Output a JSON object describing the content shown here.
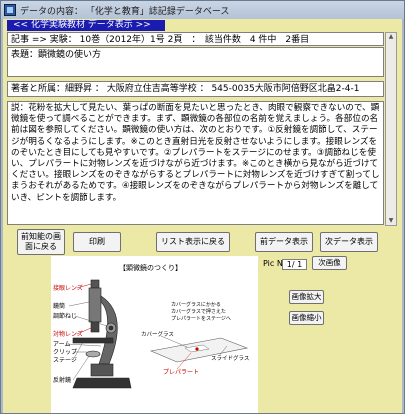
{
  "window": {
    "title": "データの内容： 「化学と教育」誌記録データベース"
  },
  "banner": "<< 化学実験教材 データ表示 >>",
  "record": {
    "text": "記事 => 実験： 10巻（2012年）1号 2頁　：　該当件数　4 件中　2番目"
  },
  "subject": {
    "text": "表題：顕微鏡の使い方"
  },
  "author": {
    "text": "著者と所属：細野昇 ： 大阪府立住吉高等学校 ： 545-0035大阪市阿倍野区北畠2-4-1"
  },
  "body": {
    "text": "説：花粉を拡大して見たい、葉っぱの断面を見たいと思ったとき、肉眼で観察できないので、顕微鏡を使って調べることができます。まず、顕微鏡の各部位の名前を覚えましょう。各部位の名前は図を参照してください。顕微鏡の使い方は、次のとおりです。①反射鏡を調節して、ステージが明るくなるようにします。※このとき直射日光を反射させないようにします。接眼レンズをのぞいたとき目にしても見やすいです。②プレパラートをステージにのせます。③調節ねじを使い、プレパラートに対物レンズを近づけながら近づけます。※このとき横から見ながら近づけてください。接眼レンズをのぞきながらするとプレパラートに対物レンズを近づけすぎて割ってしまうおそれがあるためです。④接眼レンズをのぞきながらプレパラートから対物レンズを離していき、ピントを調節します。"
  },
  "buttons": {
    "back": "前知能の画面に戻る",
    "print": "印刷",
    "list": "リスト表示に戻る",
    "prev": "前データ表示",
    "next": "次データ表示"
  },
  "image_controls": {
    "pic_no_label": "Pic No",
    "pic_no_value": "1/ 1",
    "next_image": "次画像",
    "zoom_in": "画像拡大",
    "zoom_out": "画像縮小"
  },
  "figure": {
    "title": "【顕微鏡のつくり】",
    "labels_left": [
      "接眼レンズ",
      "鏡筒",
      "調節ねじ",
      "対物レンズ",
      "アーム",
      "クリップ",
      "ステージ",
      "反射鏡"
    ],
    "caption_cover": "カバーグラス",
    "caption_slide": "スライドグラス",
    "caption_prep": "プレパラート",
    "caption_note": "カバーグラスにかかる\nカバーグラスで押さえた\nプレパラートをステージへ"
  }
}
